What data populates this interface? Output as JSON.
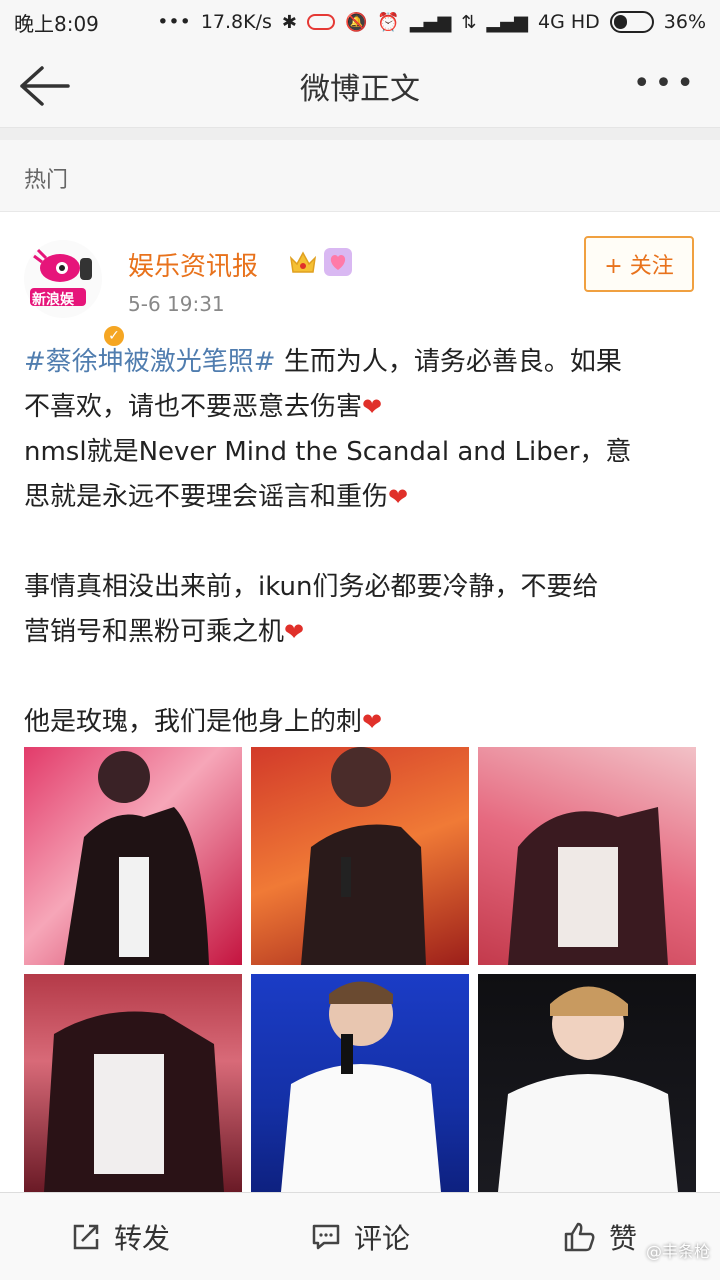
{
  "status_bar": {
    "time": "晚上8:09",
    "dots": "•••",
    "speed": "17.8K/s",
    "network": "4G HD",
    "battery": "36%",
    "battery_level": 0.36
  },
  "nav": {
    "title": "微博正文",
    "more": "•••"
  },
  "section_label": "热门",
  "post": {
    "username": "娱乐资讯报",
    "time": "5-6 19:31",
    "follow_label": "+ 关注",
    "avatar_text": "新浪娱",
    "hashtag": "#蔡徐坤被激光笔照#",
    "line1_rest": " 生而为人，请务必善良。如果",
    "line2": "不喜欢，请也不要恶意去伤害",
    "line3": "nmsl就是Never Mind the Scandal and Liber，意",
    "line4": "思就是永远不要理会谣言和重伤",
    "line5": "事情真相没出来前，ikun们务必都要冷静，不要给",
    "line6": "营销号和黑粉可乘之机",
    "line7": "他是玫瑰，我们是他身上的刺",
    "heart": "❤"
  },
  "bottom": {
    "repost": "转发",
    "comment": "评论",
    "like": "赞"
  },
  "watermark": "@丰条枪",
  "colors": {
    "accent": "#e8721c",
    "link": "#507daf",
    "heart": "#e0302a"
  }
}
